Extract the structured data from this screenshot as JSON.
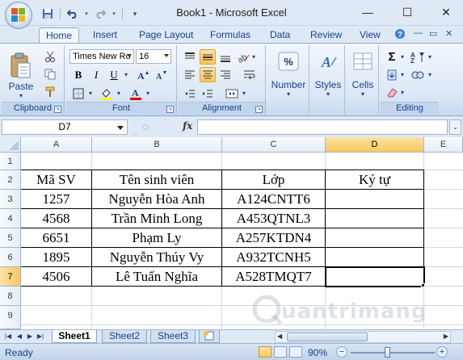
{
  "window": {
    "title": "Book1 - Microsoft Excel",
    "minimize": "—",
    "maximize": "☐",
    "close": "✕"
  },
  "qat": {
    "save_icon": "save-icon",
    "undo_icon": "undo-icon",
    "redo_icon": "redo-icon"
  },
  "tabs": [
    "Home",
    "Insert",
    "Page Layout",
    "Formulas",
    "Data",
    "Review",
    "View"
  ],
  "ribbon": {
    "clipboard": {
      "label": "Clipboard",
      "paste": "Paste"
    },
    "font": {
      "label": "Font",
      "font_name": "Times New Ro",
      "font_size": "16",
      "bold": "B",
      "italic": "I",
      "underline": "U",
      "font_color_glyph": "A"
    },
    "alignment": {
      "label": "Alignment"
    },
    "number": {
      "label": "Number",
      "glyph": "%"
    },
    "styles": {
      "label": "Styles",
      "glyph": "A"
    },
    "cells": {
      "label": "Cells"
    },
    "editing": {
      "label": "Editing",
      "sum_glyph": "Σ"
    }
  },
  "formula_bar": {
    "name_box": "D7",
    "fx": "fx",
    "formula": ""
  },
  "grid": {
    "columns": [
      "A",
      "B",
      "C",
      "D",
      "E"
    ],
    "rows": [
      "1",
      "2",
      "3",
      "4",
      "5",
      "6",
      "7",
      "8",
      "9"
    ],
    "selected_column": "D",
    "selected_row": "7",
    "table": {
      "headers": [
        "Mã SV",
        "Tên sinh viên",
        "Lớp",
        "Ký tự"
      ],
      "rows": [
        [
          "1257",
          "Nguyễn Hòa Anh",
          "A124CNTT6",
          ""
        ],
        [
          "4568",
          "Trần Minh Long",
          "A453QTNL3",
          ""
        ],
        [
          "6651",
          "Phạm Ly",
          "A257KTDN4",
          ""
        ],
        [
          "1895",
          "Nguyễn Thúy Vy",
          "A932TCNH5",
          ""
        ],
        [
          "4506",
          "Lê Tuấn Nghĩa",
          "A528TMQT7",
          ""
        ]
      ]
    }
  },
  "sheets": [
    "Sheet1",
    "Sheet2",
    "Sheet3"
  ],
  "active_sheet": "Sheet1",
  "status": {
    "text": "Ready",
    "zoom": "90%",
    "zoom_level_percent": 90
  },
  "watermark": {
    "text": "uantrimang"
  }
}
